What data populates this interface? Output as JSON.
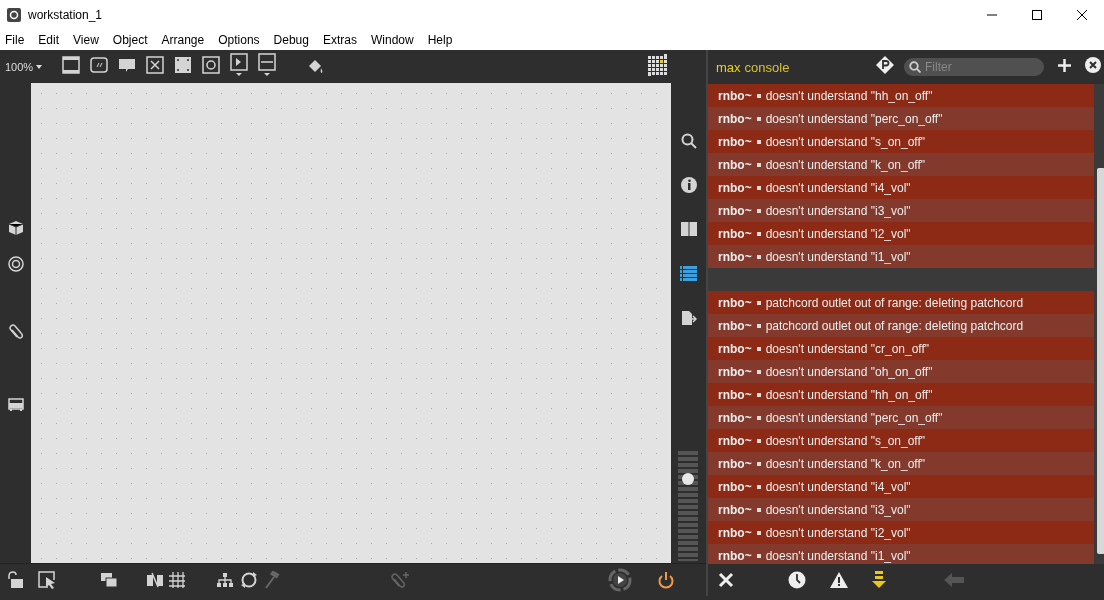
{
  "window": {
    "title": "workstation_1"
  },
  "menu": [
    "File",
    "Edit",
    "View",
    "Object",
    "Arrange",
    "Options",
    "Debug",
    "Extras",
    "Window",
    "Help"
  ],
  "toolbar": {
    "zoom": "100%"
  },
  "gain_slider": {
    "level": 0.75
  },
  "console": {
    "brand": "max",
    "title": "console",
    "filter": {
      "placeholder": "Filter"
    },
    "rows": [
      {
        "kind": "message",
        "source": "rnbo~",
        "text": "doesn't understand \"hh_on_off\""
      },
      {
        "kind": "message",
        "source": "rnbo~",
        "text": "doesn't understand \"perc_on_off\""
      },
      {
        "kind": "message",
        "source": "rnbo~",
        "text": "doesn't understand \"s_on_off\""
      },
      {
        "kind": "message",
        "source": "rnbo~",
        "text": "doesn't understand \"k_on_off\""
      },
      {
        "kind": "message",
        "source": "rnbo~",
        "text": "doesn't understand \"i4_vol\""
      },
      {
        "kind": "message",
        "source": "rnbo~",
        "text": "doesn't understand \"i3_vol\""
      },
      {
        "kind": "message",
        "source": "rnbo~",
        "text": "doesn't understand \"i2_vol\""
      },
      {
        "kind": "message",
        "source": "rnbo~",
        "text": "doesn't understand \"i1_vol\""
      },
      {
        "kind": "separator"
      },
      {
        "kind": "message",
        "source": "rnbo~",
        "text": "patchcord outlet out of range: deleting patchcord"
      },
      {
        "kind": "message",
        "source": "rnbo~",
        "text": "patchcord outlet out of range: deleting patchcord"
      },
      {
        "kind": "message",
        "source": "rnbo~",
        "text": "doesn't understand \"cr_on_off\""
      },
      {
        "kind": "message",
        "source": "rnbo~",
        "text": "doesn't understand \"oh_on_off\""
      },
      {
        "kind": "message",
        "source": "rnbo~",
        "text": "doesn't understand \"hh_on_off\""
      },
      {
        "kind": "message",
        "source": "rnbo~",
        "text": "doesn't understand \"perc_on_off\""
      },
      {
        "kind": "message",
        "source": "rnbo~",
        "text": "doesn't understand \"s_on_off\""
      },
      {
        "kind": "message",
        "source": "rnbo~",
        "text": "doesn't understand \"k_on_off\""
      },
      {
        "kind": "message",
        "source": "rnbo~",
        "text": "doesn't understand \"i4_vol\""
      },
      {
        "kind": "message",
        "source": "rnbo~",
        "text": "doesn't understand \"i3_vol\""
      },
      {
        "kind": "message",
        "source": "rnbo~",
        "text": "doesn't understand \"i2_vol\""
      },
      {
        "kind": "message",
        "source": "rnbo~",
        "text": "doesn't understand \"i1_vol\""
      }
    ]
  }
}
